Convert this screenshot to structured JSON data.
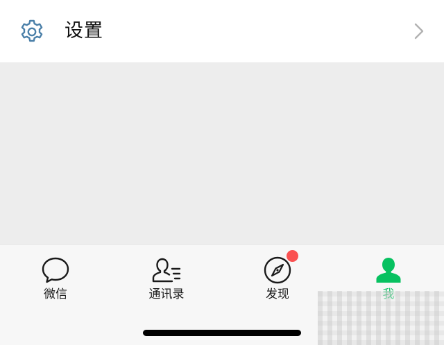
{
  "settings": {
    "icon": "gear-icon",
    "label": "设置",
    "chevron": "chevron-right-icon"
  },
  "tabbar": {
    "tabs": [
      {
        "label": "微信",
        "icon": "chat-bubble-icon",
        "active": false
      },
      {
        "label": "通讯录",
        "icon": "contacts-icon",
        "active": false
      },
      {
        "label": "发现",
        "icon": "compass-icon",
        "active": false,
        "badge": true
      },
      {
        "label": "我",
        "icon": "person-icon",
        "active": true
      }
    ]
  },
  "colors": {
    "accent": "#07c160",
    "badge": "#fa5151",
    "icon_gear": "#4a7fa8"
  }
}
